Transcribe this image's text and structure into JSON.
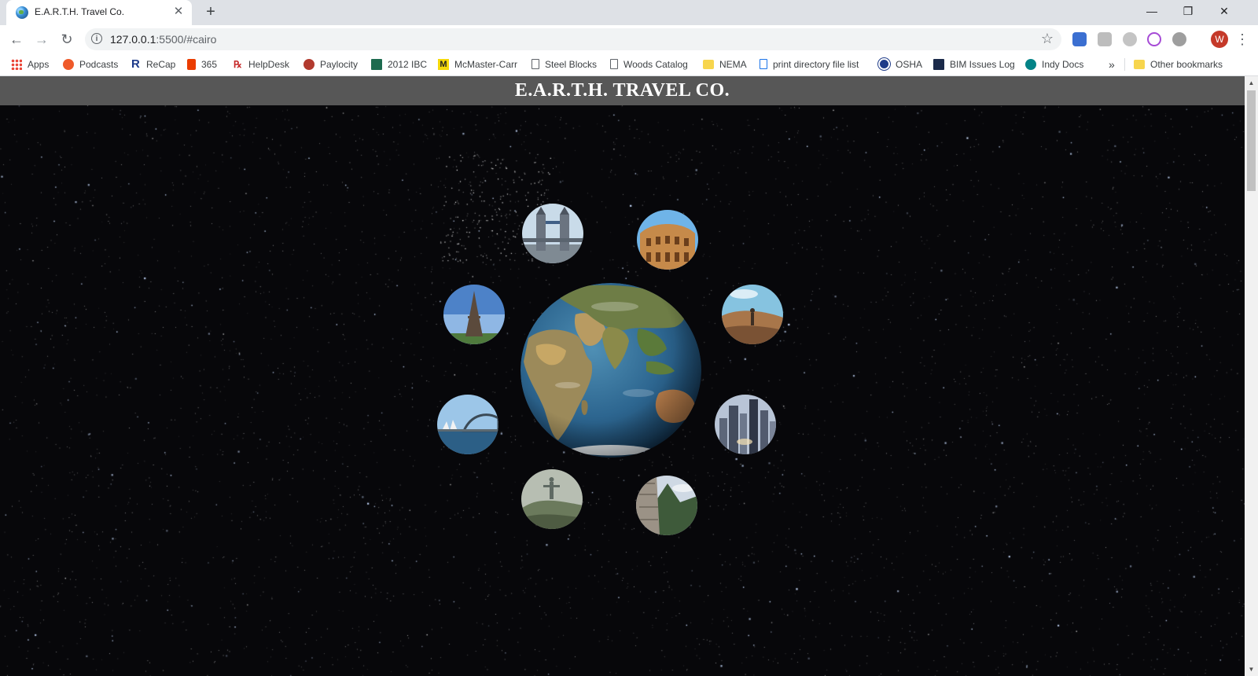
{
  "browser": {
    "tab_title": "E.A.R.T.H. Travel Co.",
    "url_host": "127.0.0.1",
    "url_path": ":5500/#cairo",
    "profile_initial": "W"
  },
  "bookmarks": [
    {
      "label": "Apps",
      "icon": "apps-grid-icon"
    },
    {
      "label": "Podcasts",
      "icon": "podcasts-icon"
    },
    {
      "label": "ReCap",
      "icon": "recap-icon"
    },
    {
      "label": "365",
      "icon": "office-365-icon"
    },
    {
      "label": "HelpDesk",
      "icon": "helpdesk-icon"
    },
    {
      "label": "Paylocity",
      "icon": "paylocity-icon"
    },
    {
      "label": "2012 IBC",
      "icon": "ibc-icon"
    },
    {
      "label": "McMaster-Carr",
      "icon": "mcmaster-icon"
    },
    {
      "label": "Steel Blocks",
      "icon": "page-icon"
    },
    {
      "label": "Woods Catalog",
      "icon": "page-icon"
    },
    {
      "label": "NEMA",
      "icon": "folder-icon"
    },
    {
      "label": "print directory file list",
      "icon": "page-icon"
    },
    {
      "label": "OSHA",
      "icon": "osha-icon"
    },
    {
      "label": "BIM Issues Log",
      "icon": "bim-icon"
    },
    {
      "label": "Indy Docs",
      "icon": "sharepoint-icon"
    }
  ],
  "bookmarks_overflow": "»",
  "other_bookmarks": "Other bookmarks",
  "page": {
    "title": "E.A.R.T.H. TRAVEL CO."
  },
  "destinations": [
    {
      "name": "tower-bridge",
      "icon": "tower-bridge-photo"
    },
    {
      "name": "colosseum",
      "icon": "colosseum-photo"
    },
    {
      "name": "eiffel-tower",
      "icon": "eiffel-tower-photo"
    },
    {
      "name": "desert-cairo",
      "icon": "desert-photo"
    },
    {
      "name": "sydney-harbour",
      "icon": "sydney-harbour-photo"
    },
    {
      "name": "city-skyline",
      "icon": "skyline-photo"
    },
    {
      "name": "christ-redeemer",
      "icon": "christ-redeemer-photo"
    },
    {
      "name": "machu-picchu",
      "icon": "machu-picchu-photo"
    }
  ],
  "colors": {
    "header_bg": "#575757",
    "space_bg": "#07070a",
    "tab_strip": "#dee1e6"
  }
}
